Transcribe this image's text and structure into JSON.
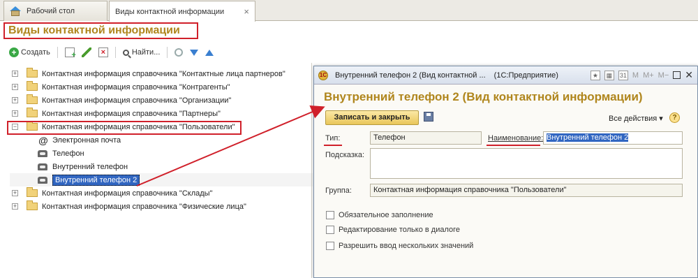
{
  "tabs": [
    {
      "label": "Рабочий стол"
    },
    {
      "label": "Виды контактной информации",
      "close": "×"
    }
  ],
  "page": {
    "title": "Виды контактной информации"
  },
  "toolbar": {
    "create_label": "Создать",
    "find_label": "Найти..."
  },
  "tree": {
    "items": [
      {
        "label": "Контактная информация справочника \"Контактные лица партнеров\""
      },
      {
        "label": "Контактная информация справочника \"Контрагенты\""
      },
      {
        "label": "Контактная информация справочника \"Организации\""
      },
      {
        "label": "Контактная информация справочника \"Партнеры\""
      },
      {
        "label": "Контактная информация справочника \"Пользователи\""
      },
      {
        "label": "Контактная информация справочника \"Склады\""
      },
      {
        "label": "Контактная информация справочника \"Физические лица\""
      }
    ],
    "children": [
      {
        "label": "Электронная почта",
        "icon": "@"
      },
      {
        "label": "Телефон"
      },
      {
        "label": "Внутренний телефон"
      },
      {
        "label": "Внутренний телефон 2"
      }
    ],
    "expand_plus": "+",
    "expand_minus": "−"
  },
  "dialog": {
    "window_title": "Внутренний телефон 2 (Вид контактной ...",
    "window_app": "(1С:Предприятие)",
    "app_icon": "1C",
    "heading": "Внутренний телефон 2 (Вид контактной информации)",
    "save_close_label": "Записать и закрыть",
    "all_actions_label": "Все действия ▾",
    "help": "?",
    "tbar": {
      "m": "M",
      "mplus": "M+",
      "mminus": "M−",
      "calendar": "31",
      "close": "✕"
    },
    "type": {
      "label": "Тип:",
      "value": "Телефон"
    },
    "name": {
      "label": "Наименование:",
      "value": "Внутренний телефон 2"
    },
    "hint": {
      "label": "Подсказка:",
      "value": ""
    },
    "group": {
      "label": "Группа:",
      "value": "Контактная информация справочника \"Пользователи\""
    },
    "checkboxes": [
      {
        "label": "Обязательное заполнение",
        "checked": false
      },
      {
        "label": "Редактирование только в диалоге",
        "checked": false
      },
      {
        "label": "Разрешить ввод нескольких значений",
        "checked": false
      }
    ]
  },
  "colors": {
    "title": "#b0861d",
    "highlight": "#d0202a",
    "selection": "#3166c1"
  }
}
